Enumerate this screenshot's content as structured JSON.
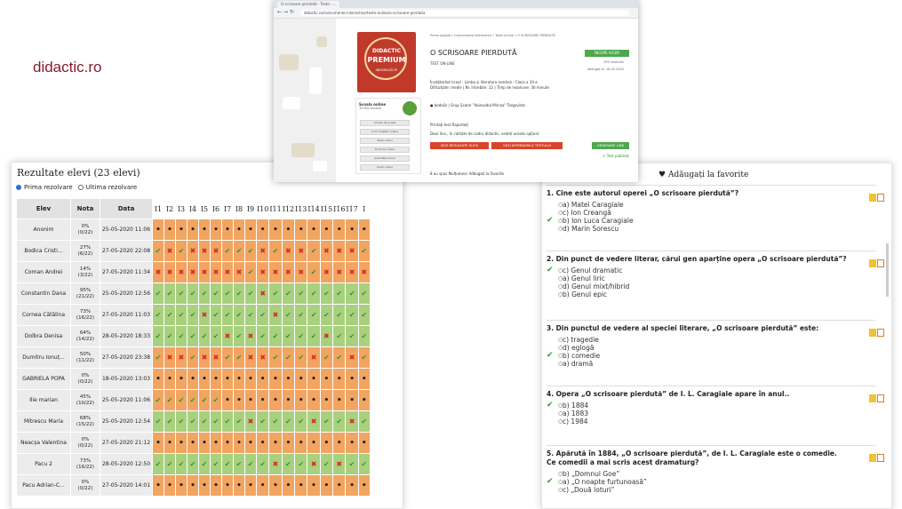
{
  "logo": "didactic.ro",
  "results": {
    "title": "Rezultate elevi (23 elevi)",
    "radio_first": "Prima rezolvare",
    "radio_last": "Ultima rezolvare",
    "columns": [
      "Elev",
      "Nota",
      "Data"
    ],
    "questions": [
      "I1",
      "I2",
      "I3",
      "I4",
      "I5",
      "I6",
      "I7",
      "I8",
      "I9",
      "I10",
      "I11",
      "I12",
      "I13",
      "I14",
      "I15",
      "I16",
      "I17",
      "I"
    ],
    "rows": [
      {
        "name": "Anonim",
        "pct": "0%",
        "frac": "(0/22)",
        "date": "25-05-2020 11:06",
        "color": "orange",
        "cells": "..................."
      },
      {
        "name": "Bodica Cristi...",
        "pct": "27%",
        "frac": "(6/22)",
        "date": "27-05-2020 22:08",
        "color": "orange",
        "cells": "vxvxxxvvvxvxxvxxxv"
      },
      {
        "name": "Coman Andrei",
        "pct": "14%",
        "frac": "(3/22)",
        "date": "27-05-2020 11:34",
        "color": "orange",
        "cells": "xxxxxxxxvxxxxvxxxx"
      },
      {
        "name": "Constantin Dana",
        "pct": "95%",
        "frac": "(21/22)",
        "date": "25-05-2020 12:56",
        "color": "green",
        "cells": "vvvvvvvvvxvvvvvvvv"
      },
      {
        "name": "Cornea Cătălina",
        "pct": "73%",
        "frac": "(16/22)",
        "date": "27-05-2020 11:03",
        "color": "green",
        "cells": "vvvvxvvvvvxvvvvvvv"
      },
      {
        "name": "Dolbra Denisa",
        "pct": "64%",
        "frac": "(14/22)",
        "date": "28-05-2020 18:33",
        "color": "green",
        "cells": "vvvvvvxvxvvvvvxvvv"
      },
      {
        "name": "Dumitru Ionuț...",
        "pct": "50%",
        "frac": "(11/22)",
        "date": "27-05-2020 23:38",
        "color": "orange",
        "cells": "vxxvxxvvxxvvvxvvxv"
      },
      {
        "name": "GABRIELA POPA",
        "pct": "0%",
        "frac": "(0/22)",
        "date": "18-05-2020 13:03",
        "color": "orange",
        "cells": ".................."
      },
      {
        "name": "Ilie marian",
        "pct": "45%",
        "frac": "(10/22)",
        "date": "25-05-2020 11:06",
        "color": "orange",
        "cells": "vvvvvv............"
      },
      {
        "name": "Mitrescu Maria",
        "pct": "68%",
        "frac": "(15/22)",
        "date": "25-05-2020 12:54",
        "color": "green",
        "cells": "vvvvvvvvxvvvvxvvxv"
      },
      {
        "name": "Neacșa Valentina",
        "pct": "0%",
        "frac": "(0/22)",
        "date": "27-05-2020 21:12",
        "color": "orange",
        "cells": ".................."
      },
      {
        "name": "Pacu 2",
        "pct": "73%",
        "frac": "(16/22)",
        "date": "28-05-2020 12:50",
        "color": "green",
        "cells": "vvvvvvvvvvxvvxvxvv"
      },
      {
        "name": "Pacu Adrian-C...",
        "pct": "0%",
        "frac": "(0/22)",
        "date": "27-05-2020 14:01",
        "color": "orange",
        "cells": ".................."
      }
    ]
  },
  "quiz": {
    "favorite": "Adăugați la favorite",
    "questions": [
      {
        "text": "1. Cine este autorul operei „O scrisoare pierdută”?",
        "options": [
          {
            "t": "a) Matei Caragiale",
            "ok": false
          },
          {
            "t": "c) Ion Creangă",
            "ok": false
          },
          {
            "t": "b) Ion Luca Caragiale",
            "ok": true
          },
          {
            "t": "d) Marin Sorescu",
            "ok": false
          }
        ]
      },
      {
        "text": "2. Din punct de vedere literar, cărui gen aparține opera „O scrisoare pierdută”?",
        "options": [
          {
            "t": "c) Genul dramatic",
            "ok": true
          },
          {
            "t": "a) Genul liric",
            "ok": false
          },
          {
            "t": "d) Genul mixt/hibrid",
            "ok": false
          },
          {
            "t": "b) Genul epic",
            "ok": false
          }
        ]
      },
      {
        "text": "3. Din punctul de vedere al speciei literare, „O scrisoare pierdută” este:",
        "options": [
          {
            "t": "c) tragedie",
            "ok": false
          },
          {
            "t": "d) eglogă",
            "ok": false
          },
          {
            "t": "b) comedie",
            "ok": true
          },
          {
            "t": "a) dramă",
            "ok": false
          }
        ]
      },
      {
        "text": "4. Opera „O scrisoare pierdută” de I. L. Caragiale apare în anul..",
        "options": [
          {
            "t": "b) 1884",
            "ok": true
          },
          {
            "t": "a) 1883",
            "ok": false
          },
          {
            "t": "c) 1984",
            "ok": false
          }
        ]
      },
      {
        "text": "5. Apărută în 1884, „O scrisoare pierdută”, de I. L. Caragiale este o comedie. Ce comedii a mai scris acest dramaturg?",
        "options": [
          {
            "t": "b) „Domnul Goe”",
            "ok": false
          },
          {
            "t": "a) „O noapte furtunoasă”",
            "ok": true
          },
          {
            "t": "c) „Două loturi”",
            "ok": false
          }
        ]
      }
    ]
  },
  "browser": {
    "tab": "O scrisoare pierdută - Teste - ...",
    "url": "didactic.ro/instrumente-interactive/teste-online/o-scrisoare-pierduta",
    "badge_top": "DIDACTIC",
    "badge_main": "PREMIUM",
    "badge_sub": "ABONEAZĂ-TE",
    "school_label": "Școala online",
    "school_count": "10784 resurse",
    "school_buttons": [
      "Școala de acasă",
      "Cum învățăm online",
      "Teste online",
      "Proiecte online",
      "Activități online",
      "Lecții online"
    ],
    "breadcrumb": "Prima pagină » Instrumente interactive » Teste online » O SCRISOARE PIERDUTĂ",
    "title": "O SCRISOARE PIERDUTĂ",
    "subtitle": "TEST ON-LINE",
    "info1": "Învățământ liceal - Limba și literatura română - Clasa a 10-a",
    "info2": "Dificultate: medie | Nr. întrebări: 22 | Timp de rezolvare: 30 minute",
    "author": "bodaliz | Grup Școlar \"Voievodul Mircea\" Targoviste",
    "actions": "Printați test   Raportați",
    "note": "Doar dvs., în calitate de cadru didactic, vedeți aceste opțiuni:",
    "btn_results": "VEZI REZULTATE ELEVI",
    "btn_results2": "VEZI INTREBARILE TESTULUI",
    "btn_start": "ÎNCEPE ACUM",
    "btn_link": "GENERARE LINK",
    "published": "Test publicat",
    "meta1": "399 rezolvări",
    "meta2": "Adăugat la: 18.05.2020",
    "footer": "8 au spus Mulțumesc       Adăugați la favorite"
  }
}
